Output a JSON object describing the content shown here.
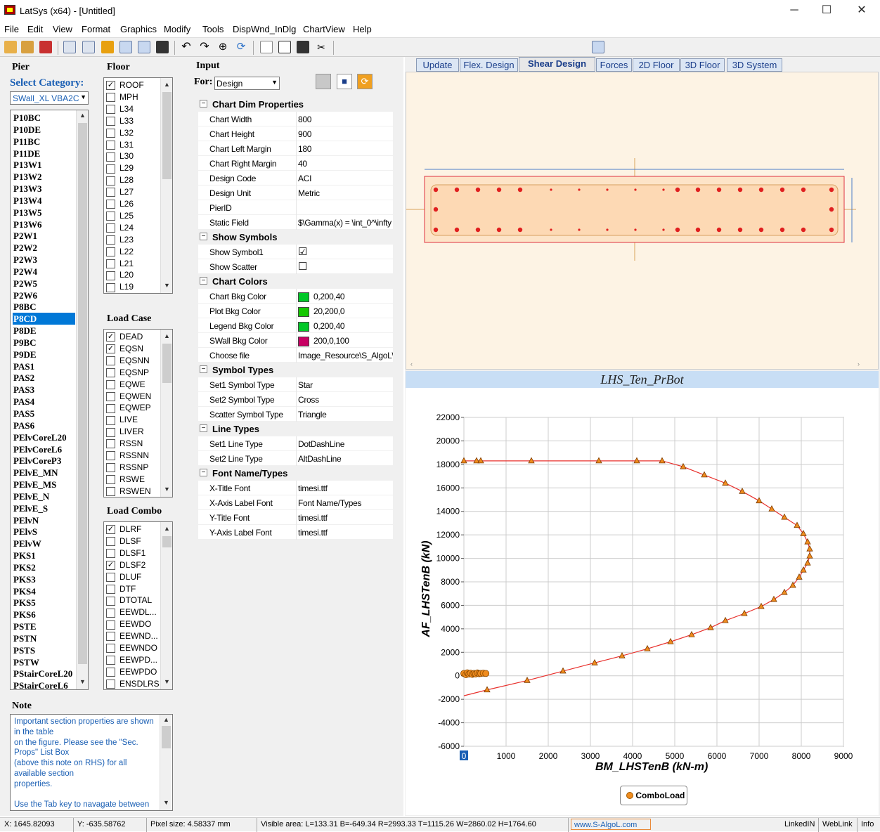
{
  "window": {
    "title": "LatSys (x64) - [Untitled]",
    "minimize": "─",
    "maximize": "☐",
    "close": "✕"
  },
  "menu": [
    "File",
    "Edit",
    "View",
    "Format",
    "Graphics",
    "Modify",
    "Tools",
    "DispWnd_InDlg",
    "ChartView",
    "Help"
  ],
  "pier": {
    "heading": "Pier",
    "category_label": "Select Category:",
    "category_value": "SWall_XL VBA2C",
    "items": [
      "P10BC",
      "P10DE",
      "P11BC",
      "P11DE",
      "P13W1",
      "P13W2",
      "P13W3",
      "P13W4",
      "P13W5",
      "P13W6",
      "P2W1",
      "P2W2",
      "P2W3",
      "P2W4",
      "P2W5",
      "P2W6",
      "P8BC",
      "P8CD",
      "P8DE",
      "P9BC",
      "P9DE",
      "PAS1",
      "PAS2",
      "PAS3",
      "PAS4",
      "PAS5",
      "PAS6",
      "PElvCoreL20",
      "PElvCoreL6",
      "PElvCoreP3",
      "PElvE_MN",
      "PElvE_MS",
      "PElvE_N",
      "PElvE_S",
      "PElvN",
      "PElvS",
      "PElvW",
      "PKS1",
      "PKS2",
      "PKS3",
      "PKS4",
      "PKS5",
      "PKS6",
      "PSTE",
      "PSTN",
      "PSTS",
      "PSTW",
      "PStairCoreL20",
      "PStairCoreL6"
    ],
    "selected": "P8CD"
  },
  "floor": {
    "heading": "Floor",
    "items": [
      {
        "label": "ROOF",
        "checked": true
      },
      {
        "label": "MPH",
        "checked": false
      },
      {
        "label": "L34",
        "checked": false
      },
      {
        "label": "L33",
        "checked": false
      },
      {
        "label": "L32",
        "checked": false
      },
      {
        "label": "L31",
        "checked": false
      },
      {
        "label": "L30",
        "checked": false
      },
      {
        "label": "L29",
        "checked": false
      },
      {
        "label": "L28",
        "checked": false
      },
      {
        "label": "L27",
        "checked": false
      },
      {
        "label": "L26",
        "checked": false
      },
      {
        "label": "L25",
        "checked": false
      },
      {
        "label": "L24",
        "checked": false
      },
      {
        "label": "L23",
        "checked": false
      },
      {
        "label": "L22",
        "checked": false
      },
      {
        "label": "L21",
        "checked": false
      },
      {
        "label": "L20",
        "checked": false
      },
      {
        "label": "L19",
        "checked": false
      }
    ]
  },
  "load_case": {
    "heading": "Load Case",
    "items": [
      {
        "label": "DEAD",
        "checked": true
      },
      {
        "label": "EQSN",
        "checked": true
      },
      {
        "label": "EQSNN",
        "checked": false
      },
      {
        "label": "EQSNP",
        "checked": false
      },
      {
        "label": "EQWE",
        "checked": false
      },
      {
        "label": "EQWEN",
        "checked": false
      },
      {
        "label": "EQWEP",
        "checked": false
      },
      {
        "label": "LIVE",
        "checked": false
      },
      {
        "label": "LIVER",
        "checked": false
      },
      {
        "label": "RSSN",
        "checked": false
      },
      {
        "label": "RSSNN",
        "checked": false
      },
      {
        "label": "RSSNP",
        "checked": false
      },
      {
        "label": "RSWE",
        "checked": false
      },
      {
        "label": "RSWEN",
        "checked": false
      }
    ]
  },
  "load_combo": {
    "heading": "Load Combo",
    "items": [
      {
        "label": "DLRF",
        "checked": true
      },
      {
        "label": "DLSF",
        "checked": false
      },
      {
        "label": "DLSF1",
        "checked": false
      },
      {
        "label": "DLSF2",
        "checked": true
      },
      {
        "label": "DLUF",
        "checked": false
      },
      {
        "label": "DTF",
        "checked": false
      },
      {
        "label": "DTOTAL",
        "checked": false
      },
      {
        "label": "EEWDL...",
        "checked": false
      },
      {
        "label": "EEWDO",
        "checked": false
      },
      {
        "label": "EEWND...",
        "checked": false
      },
      {
        "label": "EEWNDO",
        "checked": false
      },
      {
        "label": "EEWPD...",
        "checked": false
      },
      {
        "label": "EEWPDO",
        "checked": false
      },
      {
        "label": "ENSDLRS",
        "checked": false
      }
    ]
  },
  "note": {
    "heading": "Note",
    "lines": [
      "Important section properties are shown",
      "in the table",
      "on the figure. Please see the \"Sec.",
      "Props\" List Box",
      "(above this note on RHS) for all",
      "available section",
      "properties.",
      "",
      "Use the Tab key to navagate between"
    ]
  },
  "input": {
    "heading": "Input",
    "for_label": "For:",
    "for_value": "Design",
    "sections": [
      {
        "title": "Chart Dim Properties",
        "rows": [
          [
            "Chart Width",
            "800"
          ],
          [
            "Chart Height",
            "900"
          ],
          [
            "Chart Left Margin",
            "180"
          ],
          [
            "Chart Right Margin",
            "40"
          ],
          [
            "Design Code",
            "ACI"
          ],
          [
            "Design Unit",
            "Metric"
          ],
          [
            "PierID",
            ""
          ],
          [
            "Static Field",
            "$\\Gamma(x) = \\int_0^\\infty"
          ]
        ]
      },
      {
        "title": "Show Symbols",
        "rows": [
          [
            "Show Symbol1",
            "☑"
          ],
          [
            "Show Scatter",
            "☐"
          ]
        ]
      },
      {
        "title": "Chart Colors",
        "rows": [
          [
            "Chart Bkg Color",
            "0,200,40"
          ],
          [
            "Plot Bkg Color",
            "20,200,0"
          ],
          [
            "Legend Bkg Color",
            "0,200,40"
          ],
          [
            "SWall Bkg Color",
            "200,0,100"
          ],
          [
            "Choose file",
            "Image_Resource\\S_AlgoL\\"
          ]
        ]
      },
      {
        "title": "Symbol Types",
        "rows": [
          [
            "Set1 Symbol Type",
            "Star"
          ],
          [
            "Set2 Symbol Type",
            "Cross"
          ],
          [
            "Scatter Symbol Type",
            "Triangle"
          ]
        ]
      },
      {
        "title": "Line Types",
        "rows": [
          [
            "Set1 Line Type",
            "DotDashLine"
          ],
          [
            "Set2 Line Type",
            "AltDashLine"
          ]
        ]
      },
      {
        "title": "Font Name/Types",
        "rows": [
          [
            "X-Title Font",
            "timesi.ttf"
          ],
          [
            "X-Axis Label Font",
            "Font Name/Types"
          ],
          [
            "Y-Title Font",
            "timesi.ttf"
          ],
          [
            "Y-Axis Label Font",
            "timesi.ttf"
          ]
        ]
      }
    ],
    "swatch_colors": {
      "Chart Bkg Color": "#00c828",
      "Plot Bkg Color": "#14c800",
      "Legend Bkg Color": "#00c828",
      "SWall Bkg Color": "#c80064"
    }
  },
  "tabs": [
    "Update",
    "Flex. Design",
    "Shear Design",
    "Forces",
    "2D Floor",
    "3D Floor",
    "3D System"
  ],
  "active_tab": "Shear Design",
  "chart_data": {
    "type": "line",
    "title": "LHS_Ten_PrBot",
    "xlabel": "BM_LHSTenB (kN-m)",
    "ylabel": "AF_LHSTenB (kN)",
    "xlim": [
      0,
      9000
    ],
    "ylim": [
      -6000,
      22000
    ],
    "x_ticks": [
      0,
      1000,
      2000,
      3000,
      4000,
      5000,
      6000,
      7000,
      8000,
      9000
    ],
    "y_ticks": [
      -6000,
      -4000,
      -2000,
      0,
      2000,
      4000,
      6000,
      8000,
      10000,
      12000,
      14000,
      16000,
      18000,
      20000,
      22000
    ],
    "series": [
      {
        "name": "",
        "color": "#e8302c",
        "points": [
          [
            0,
            18300
          ],
          [
            300,
            18300
          ],
          [
            1600,
            18300
          ],
          [
            3200,
            18300
          ],
          [
            4100,
            18300
          ],
          [
            4700,
            18300
          ],
          [
            5200,
            17800
          ],
          [
            5700,
            17100
          ],
          [
            6200,
            16400
          ],
          [
            6600,
            15700
          ],
          [
            7000,
            14900
          ],
          [
            7300,
            14200
          ],
          [
            7600,
            13500
          ],
          [
            7900,
            12800
          ],
          [
            8050,
            12100
          ],
          [
            8150,
            11400
          ],
          [
            8200,
            10800
          ],
          [
            8200,
            10200
          ],
          [
            8150,
            9600
          ],
          [
            8050,
            9000
          ],
          [
            7950,
            8400
          ],
          [
            7800,
            7700
          ],
          [
            7600,
            7100
          ],
          [
            7350,
            6500
          ],
          [
            7050,
            5900
          ],
          [
            6650,
            5300
          ],
          [
            6200,
            4700
          ],
          [
            5850,
            4100
          ],
          [
            5400,
            3500
          ],
          [
            4900,
            2900
          ],
          [
            4350,
            2300
          ],
          [
            3750,
            1700
          ],
          [
            3100,
            1100
          ],
          [
            2350,
            400
          ],
          [
            1500,
            -400
          ],
          [
            550,
            -1200
          ],
          [
            0,
            -1700
          ]
        ],
        "markers": [
          [
            0,
            18300
          ],
          [
            300,
            18300
          ],
          [
            400,
            18300
          ],
          [
            1600,
            18300
          ],
          [
            3200,
            18300
          ],
          [
            4100,
            18300
          ],
          [
            4700,
            18300
          ],
          [
            5200,
            17800
          ],
          [
            5700,
            17100
          ],
          [
            6200,
            16400
          ],
          [
            6600,
            15700
          ],
          [
            7000,
            14900
          ],
          [
            7300,
            14200
          ],
          [
            7600,
            13500
          ],
          [
            7900,
            12800
          ],
          [
            8050,
            12100
          ],
          [
            8150,
            11400
          ],
          [
            8200,
            10800
          ],
          [
            8200,
            10200
          ],
          [
            8150,
            9600
          ],
          [
            8050,
            9000
          ],
          [
            7950,
            8400
          ],
          [
            7800,
            7700
          ],
          [
            7600,
            7100
          ],
          [
            7350,
            6500
          ],
          [
            7050,
            5900
          ],
          [
            6650,
            5300
          ],
          [
            6200,
            4700
          ],
          [
            5850,
            4100
          ],
          [
            5400,
            3500
          ],
          [
            4900,
            2900
          ],
          [
            4350,
            2300
          ],
          [
            3750,
            1700
          ],
          [
            3100,
            1100
          ],
          [
            2350,
            400
          ],
          [
            1500,
            -400
          ],
          [
            550,
            -1200
          ]
        ]
      },
      {
        "name": "ComboLoad",
        "color": "#f08c1e",
        "points": [
          [
            0,
            200
          ],
          [
            50,
            100
          ],
          [
            80,
            250
          ],
          [
            120,
            150
          ],
          [
            160,
            220
          ],
          [
            200,
            120
          ],
          [
            240,
            200
          ],
          [
            280,
            160
          ],
          [
            320,
            240
          ],
          [
            360,
            180
          ],
          [
            400,
            200
          ],
          [
            460,
            220
          ],
          [
            520,
            200
          ]
        ]
      }
    ],
    "legend": "bottom-center",
    "grid": true
  },
  "status": {
    "x": "X: 1645.82093",
    "y": "Y: -635.58762",
    "pixel": "Pixel size: 4.58337 mm",
    "visible": "Visible area:  L=133.31  B=-649.34  R=2993.33  T=1115.26   W=2860.02  H=1764.60",
    "web": "www.S-AlgoL.com",
    "linkedin": "LinkedIN",
    "weblink": "WebLink",
    "info": "Info"
  }
}
